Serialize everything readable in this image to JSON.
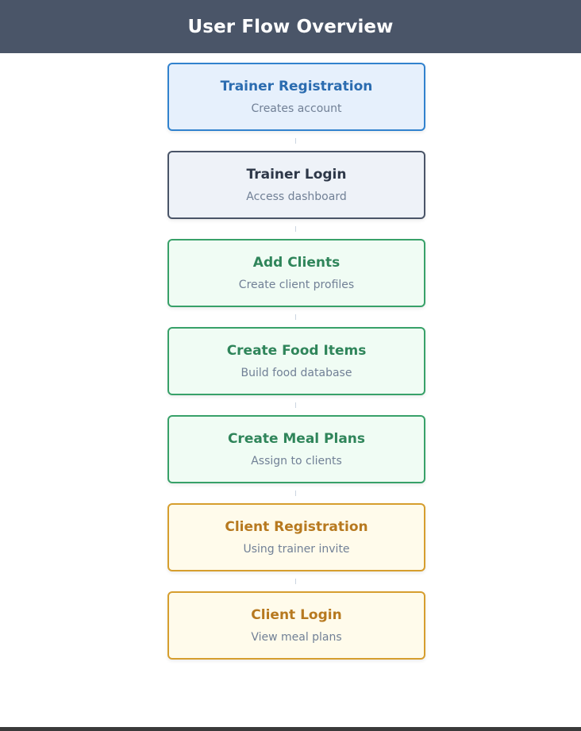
{
  "header": {
    "title": "User Flow Overview"
  },
  "steps": [
    {
      "title": "Trainer Registration",
      "description": "Creates account",
      "color": "#3182ce"
    },
    {
      "title": "Trainer Login",
      "description": "Access dashboard",
      "color": "#4a5568"
    },
    {
      "title": "Add Clients",
      "description": "Create client profiles",
      "color": "#38a169"
    },
    {
      "title": "Create Food Items",
      "description": "Build food database",
      "color": "#38a169"
    },
    {
      "title": "Create Meal Plans",
      "description": "Assign to clients",
      "color": "#38a169"
    },
    {
      "title": "Client Registration",
      "description": "Using trainer invite",
      "color": "#d69e2e"
    },
    {
      "title": "Client Login",
      "description": "View meal plans",
      "color": "#d69e2e"
    }
  ]
}
